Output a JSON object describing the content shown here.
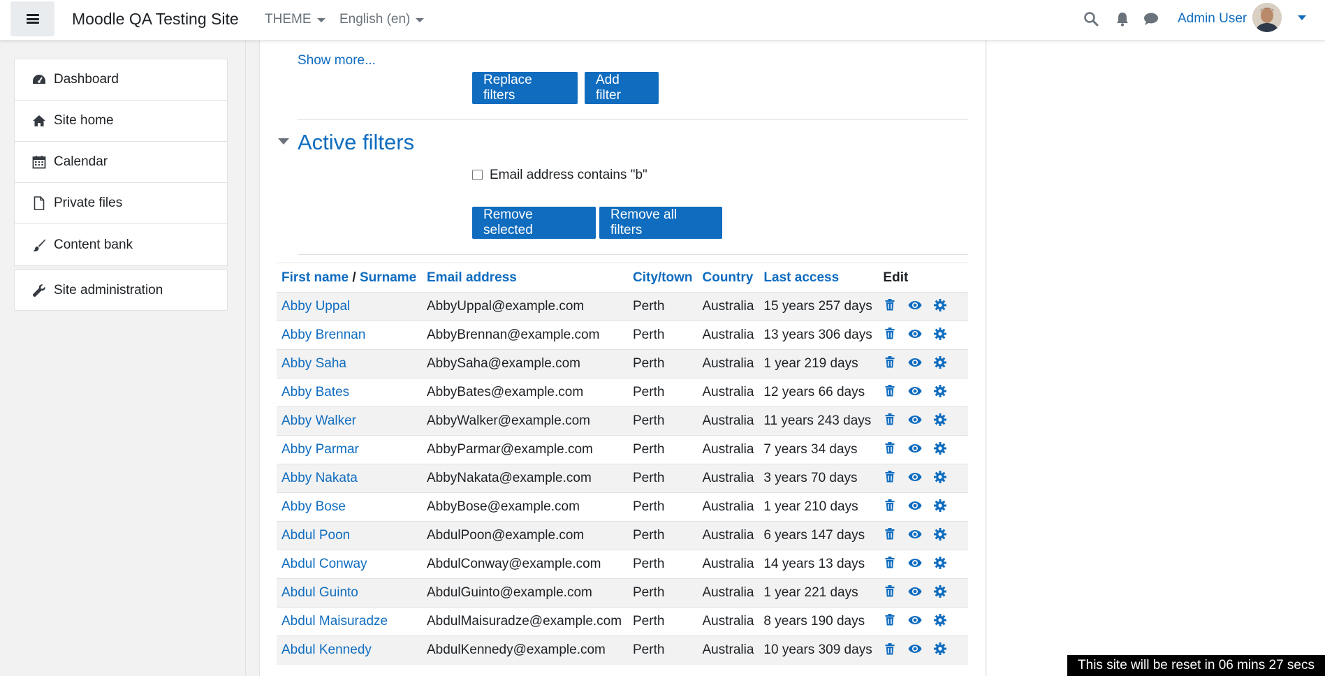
{
  "navbar": {
    "site_name": "Moodle QA Testing Site",
    "theme_menu": "THEME",
    "language_menu": "English (en)",
    "user_name": "Admin User"
  },
  "drawer": {
    "items": [
      {
        "label": "Dashboard",
        "icon": "dashboard-icon"
      },
      {
        "label": "Site home",
        "icon": "home-icon"
      },
      {
        "label": "Calendar",
        "icon": "calendar-icon"
      },
      {
        "label": "Private files",
        "icon": "file-icon"
      },
      {
        "label": "Content bank",
        "icon": "paintbrush-icon"
      }
    ],
    "admin_label": "Site administration"
  },
  "filters": {
    "show_more": "Show more...",
    "replace_label": "Replace filters",
    "add_label": "Add filter",
    "active_heading": "Active filters",
    "active_filter_label": "Email address contains \"b\"",
    "remove_selected_label": "Remove selected",
    "remove_all_label": "Remove all filters"
  },
  "table": {
    "headers": {
      "first_name": "First name",
      "separator": "/",
      "surname": "Surname",
      "email": "Email address",
      "city": "City/town",
      "country": "Country",
      "last_access": "Last access",
      "edit": "Edit"
    },
    "rows": [
      {
        "name": "Abby Uppal",
        "email": "AbbyUppal@example.com",
        "city": "Perth",
        "country": "Australia",
        "last_access": "15 years 257 days"
      },
      {
        "name": "Abby Brennan",
        "email": "AbbyBrennan@example.com",
        "city": "Perth",
        "country": "Australia",
        "last_access": "13 years 306 days"
      },
      {
        "name": "Abby Saha",
        "email": "AbbySaha@example.com",
        "city": "Perth",
        "country": "Australia",
        "last_access": "1 year 219 days"
      },
      {
        "name": "Abby Bates",
        "email": "AbbyBates@example.com",
        "city": "Perth",
        "country": "Australia",
        "last_access": "12 years 66 days"
      },
      {
        "name": "Abby Walker",
        "email": "AbbyWalker@example.com",
        "city": "Perth",
        "country": "Australia",
        "last_access": "11 years 243 days"
      },
      {
        "name": "Abby Parmar",
        "email": "AbbyParmar@example.com",
        "city": "Perth",
        "country": "Australia",
        "last_access": "7 years 34 days"
      },
      {
        "name": "Abby Nakata",
        "email": "AbbyNakata@example.com",
        "city": "Perth",
        "country": "Australia",
        "last_access": "3 years 70 days"
      },
      {
        "name": "Abby Bose",
        "email": "AbbyBose@example.com",
        "city": "Perth",
        "country": "Australia",
        "last_access": "1 year 210 days"
      },
      {
        "name": "Abdul Poon",
        "email": "AbdulPoon@example.com",
        "city": "Perth",
        "country": "Australia",
        "last_access": "6 years 147 days"
      },
      {
        "name": "Abdul Conway",
        "email": "AbdulConway@example.com",
        "city": "Perth",
        "country": "Australia",
        "last_access": "14 years 13 days"
      },
      {
        "name": "Abdul Guinto",
        "email": "AbdulGuinto@example.com",
        "city": "Perth",
        "country": "Australia",
        "last_access": "1 year 221 days"
      },
      {
        "name": "Abdul Maisuradze",
        "email": "AbdulMaisuradze@example.com",
        "city": "Perth",
        "country": "Australia",
        "last_access": "8 years 190 days"
      },
      {
        "name": "Abdul Kennedy",
        "email": "AbdulKennedy@example.com",
        "city": "Perth",
        "country": "Australia",
        "last_access": "10 years 309 days"
      }
    ]
  },
  "reset_banner": "This site will be reset in 06 mins 27 secs",
  "colors": {
    "accent": "#0f6cbf",
    "drawer_bg": "#f2f2f2",
    "banner_bg": "#000000"
  }
}
